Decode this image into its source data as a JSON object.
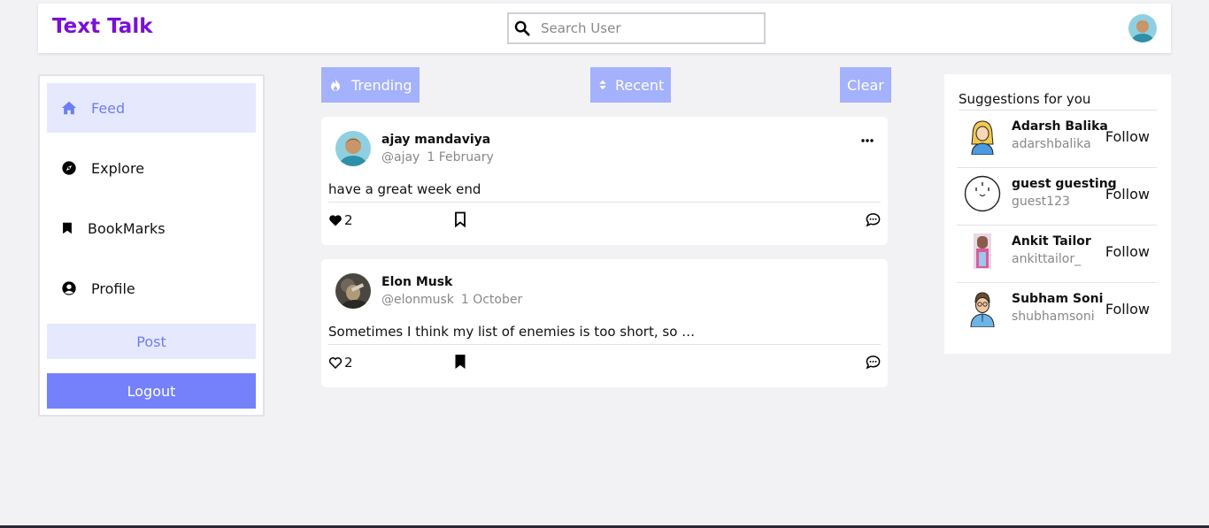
{
  "header": {
    "logo": "Text Talk",
    "search_placeholder": "Search User",
    "colors": {
      "logo": "#7a0fd6"
    }
  },
  "sidebar": {
    "items": [
      {
        "label": "Feed",
        "icon": "home-icon",
        "active": true
      },
      {
        "label": "Explore",
        "icon": "compass-icon",
        "active": false
      },
      {
        "label": "BookMarks",
        "icon": "bookmark-icon",
        "active": false
      },
      {
        "label": "Profile",
        "icon": "user-circle-icon",
        "active": false
      }
    ],
    "post_label": "Post",
    "logout_label": "Logout"
  },
  "filters": {
    "trending": "Trending",
    "recent": "Recent",
    "clear": "Clear"
  },
  "posts": [
    {
      "name": "ajay mandaviya",
      "handle": "@ajay",
      "date": "1 February",
      "text": "have a great week end",
      "likes": "2",
      "liked": true,
      "bookmarked": false
    },
    {
      "name": "Elon Musk",
      "handle": "@elonmusk",
      "date": "1 October",
      "text": "Sometimes I think my list of enemies is too short, so …",
      "likes": "2",
      "liked": false,
      "bookmarked": true
    }
  ],
  "suggestions": {
    "title": "Suggestions for you",
    "follow_label": "Follow",
    "users": [
      {
        "name": "Adarsh Balika",
        "handle": "adarshbalika"
      },
      {
        "name": "guest guesting",
        "handle": "guest123"
      },
      {
        "name": "Ankit Tailor",
        "handle": "ankittailor_"
      },
      {
        "name": "Subham Soni",
        "handle": "shubhamsoni"
      }
    ]
  }
}
